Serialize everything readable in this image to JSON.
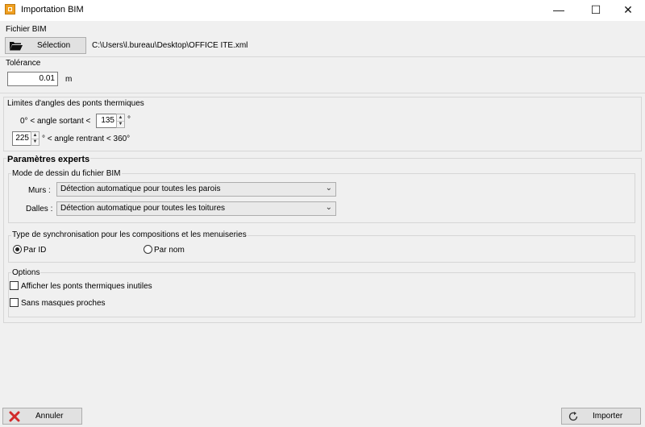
{
  "window": {
    "title": "Importation BIM",
    "minimize_glyph": "—",
    "maximize_glyph": "☐",
    "close_glyph": "✕"
  },
  "fichier": {
    "section_label": "Fichier BIM",
    "selection_label": "Sélection",
    "path": "C:\\Users\\l.bureau\\Desktop\\OFFICE ITE.xml"
  },
  "tolerance": {
    "section_label": "Tolérance",
    "value": "0.01",
    "unit": "m"
  },
  "angles": {
    "section_label": "Limites d'angles des ponts thermiques",
    "sortant_prefix": "0° < angle sortant <",
    "sortant_value": "135",
    "sortant_suffix": "°",
    "rentrant_value": "225",
    "rentrant_suffix": "° <  angle rentrant < 360°"
  },
  "experts": {
    "title": "Paramètres experts",
    "mode_dessin": {
      "label": "Mode de dessin du fichier BIM",
      "murs_label": "Murs :",
      "murs_value": "Détection automatique pour toutes les parois",
      "dalles_label": "Dalles :",
      "dalles_value": "Détection automatique pour toutes les toitures"
    },
    "synchro": {
      "label": "Type de synchronisation pour les compositions et les menuiseries",
      "option_id": "Par ID",
      "option_nom": "Par nom",
      "selected": "Par ID"
    },
    "options": {
      "label": "Options",
      "afficher_ponts": "Afficher les ponts thermiques inutiles",
      "afficher_ponts_checked": false,
      "sans_masques": "Sans masques proches",
      "sans_masques_checked": false
    }
  },
  "footer": {
    "annuler_label": "Annuler",
    "importer_label": "Importer"
  },
  "colors": {
    "background": "#f0f0f0",
    "cancel_icon": "#d22b2b",
    "app_icon": "#f0a020"
  }
}
